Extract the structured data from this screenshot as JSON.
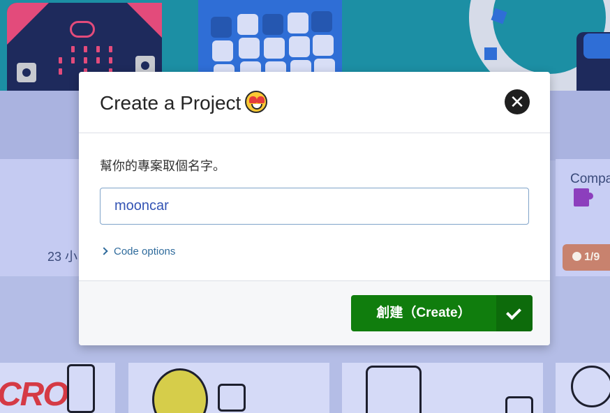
{
  "background": {
    "card_count_text": "23 小",
    "side_card_title": "Compa",
    "side_card_badge": "1/9"
  },
  "dialog": {
    "title": "Create a Project",
    "title_emoji": "heart-eyes-emoji",
    "prompt": "幫你的專案取個名字。",
    "name_input_value": "mooncar",
    "code_options_label": "Code options",
    "create_button_label": "創建（Create）"
  },
  "colors": {
    "create_button": "#107d0d",
    "link": "#2f6b9c",
    "hero": "#1c8fa4"
  },
  "icons": [
    "close-icon",
    "chevron-right-icon",
    "check-icon",
    "puzzle-icon"
  ]
}
